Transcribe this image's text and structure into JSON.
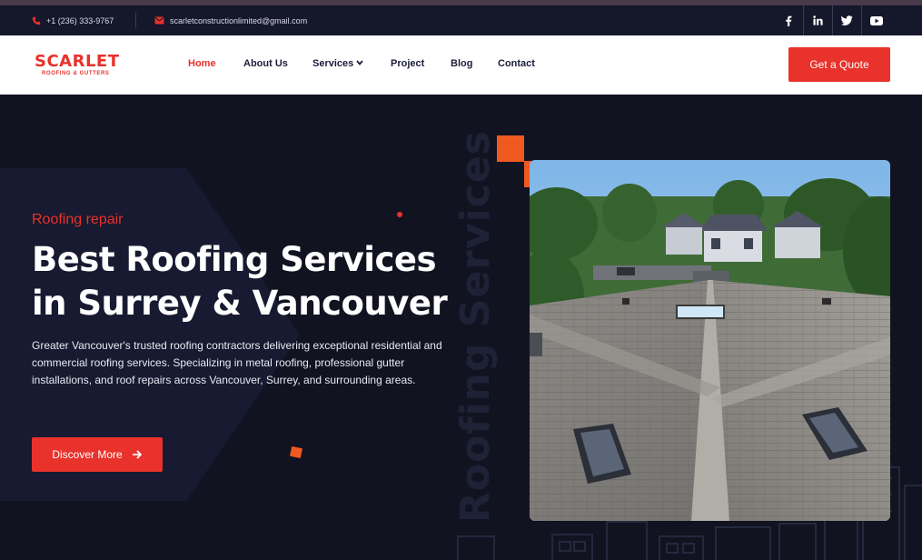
{
  "topbar": {
    "phone": "+1 (236) 333-9767",
    "email": "scarletconstructionlimited@gmail.com",
    "socials": [
      "facebook-icon",
      "linkedin-icon",
      "twitter-icon",
      "youtube-icon"
    ]
  },
  "nav": {
    "logo_text": "SCARLET",
    "logo_sub": "ROOFING & GUTTERS",
    "items": [
      {
        "label": "Home",
        "active": true
      },
      {
        "label": "About Us",
        "active": false
      },
      {
        "label": "Services",
        "active": false
      },
      {
        "label": "Project",
        "active": false
      },
      {
        "label": "Blog",
        "active": false
      },
      {
        "label": "Contact",
        "active": false
      }
    ],
    "quote_button": "Get a Quote"
  },
  "hero": {
    "eyebrow": "Roofing repair",
    "title_line1": "Best Roofing Services",
    "title_line2": "in Surrey & Vancouver",
    "description": "Greater Vancouver's trusted roofing contractors delivering exceptional residential and commercial roofing services. Specializing in metal roofing, professional gutter installations, and roof repairs across Vancouver, Surrey, and surrounding areas.",
    "button": "Discover More",
    "vertical_text": "Roofing Services"
  },
  "colors": {
    "accent": "#e8322b",
    "orange": "#f0591f",
    "background": "#121321",
    "topbar": "#15172a",
    "nav_text": "#1b1e3a"
  }
}
